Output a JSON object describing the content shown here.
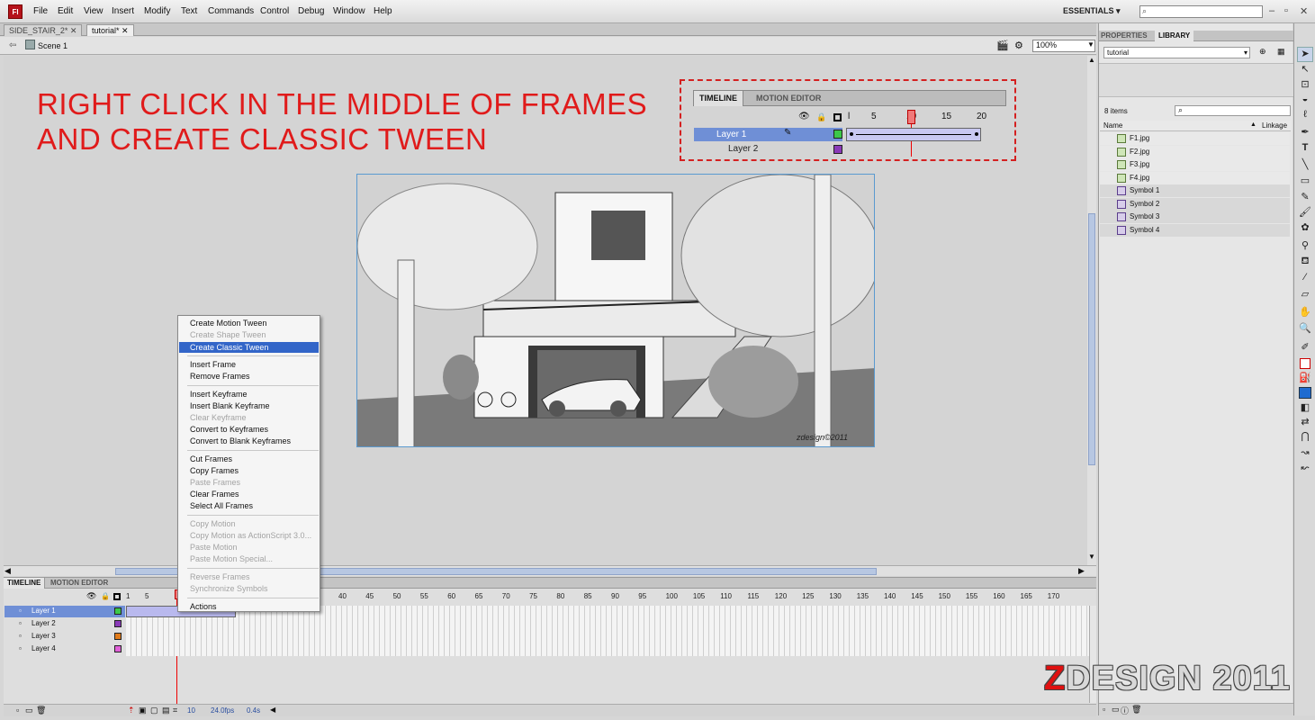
{
  "app": {
    "logo": "Fl"
  },
  "menu": [
    "File",
    "Edit",
    "View",
    "Insert",
    "Modify",
    "Text",
    "Commands",
    "Control",
    "Debug",
    "Window",
    "Help"
  ],
  "workspace": {
    "label": "ESSENTIALS ▾",
    "search_placeholder": ""
  },
  "tabs": [
    {
      "label": "SIDE_STAIR_2*"
    },
    {
      "label": "tutorial*"
    }
  ],
  "editbar": {
    "scene": "Scene 1",
    "zoom": "100%"
  },
  "instruction": {
    "line1": "RIGHT CLICK IN THE MIDDLE OF FRAMES",
    "line2": "AND CREATE CLASSIC TWEEN"
  },
  "inset": {
    "tabs": [
      "TIMELINE",
      "MOTION EDITOR"
    ],
    "ruler": [
      "l",
      "5",
      "10",
      "15",
      "20"
    ],
    "layers": [
      "Layer 1",
      "Layer 2"
    ]
  },
  "photo": {
    "watermark": "zdesign©2011"
  },
  "context_menu": [
    {
      "label": "Create Motion Tween",
      "state": "enabled"
    },
    {
      "label": "Create Shape Tween",
      "state": "disabled"
    },
    {
      "label": "Create Classic Tween",
      "state": "selected"
    },
    {
      "label": "Insert Frame",
      "state": "enabled",
      "sep_before": true
    },
    {
      "label": "Remove Frames",
      "state": "enabled"
    },
    {
      "label": "Insert Keyframe",
      "state": "enabled",
      "sep_before": true
    },
    {
      "label": "Insert Blank Keyframe",
      "state": "enabled"
    },
    {
      "label": "Clear Keyframe",
      "state": "disabled"
    },
    {
      "label": "Convert to Keyframes",
      "state": "enabled"
    },
    {
      "label": "Convert to Blank Keyframes",
      "state": "enabled"
    },
    {
      "label": "Cut Frames",
      "state": "enabled",
      "sep_before": true
    },
    {
      "label": "Copy Frames",
      "state": "enabled"
    },
    {
      "label": "Paste Frames",
      "state": "disabled"
    },
    {
      "label": "Clear Frames",
      "state": "enabled"
    },
    {
      "label": "Select All Frames",
      "state": "enabled"
    },
    {
      "label": "Copy Motion",
      "state": "disabled",
      "sep_before": true
    },
    {
      "label": "Copy Motion as ActionScript 3.0...",
      "state": "disabled"
    },
    {
      "label": "Paste Motion",
      "state": "disabled"
    },
    {
      "label": "Paste Motion Special...",
      "state": "disabled"
    },
    {
      "label": "Reverse Frames",
      "state": "disabled",
      "sep_before": true
    },
    {
      "label": "Synchronize Symbols",
      "state": "disabled"
    },
    {
      "label": "Actions",
      "state": "enabled",
      "sep_before": true
    }
  ],
  "timeline": {
    "tabs": [
      "TIMELINE",
      "MOTION EDITOR"
    ],
    "ruler": [
      "1",
      "5",
      "40",
      "45",
      "50",
      "55",
      "60",
      "65",
      "70",
      "75",
      "80",
      "85",
      "90",
      "95",
      "100",
      "105",
      "110",
      "115",
      "120",
      "125",
      "130",
      "135",
      "140",
      "145",
      "150",
      "155",
      "160",
      "165",
      "170"
    ],
    "layers": [
      {
        "name": "Layer 1",
        "color": "#3cc84a"
      },
      {
        "name": "Layer 2",
        "color": "#8a3ab8"
      },
      {
        "name": "Layer 3",
        "color": "#e07a1a"
      },
      {
        "name": "Layer 4",
        "color": "#e060d8"
      }
    ],
    "status": {
      "frame": "10",
      "fps": "24.0fps",
      "time": "0.4s"
    }
  },
  "panel": {
    "tabs": [
      "PROPERTIES",
      "LIBRARY"
    ],
    "library_doc": "tutorial",
    "item_count": "8 items",
    "col_name": "Name",
    "col_linkage": "Linkage",
    "items": [
      {
        "name": "F1.jpg",
        "kind": "bitmap"
      },
      {
        "name": "F2.jpg",
        "kind": "bitmap"
      },
      {
        "name": "F3.jpg",
        "kind": "bitmap"
      },
      {
        "name": "F4.jpg",
        "kind": "bitmap"
      },
      {
        "name": "Symbol 1",
        "kind": "symbol"
      },
      {
        "name": "Symbol 2",
        "kind": "symbol"
      },
      {
        "name": "Symbol 3",
        "kind": "symbol"
      },
      {
        "name": "Symbol 4",
        "kind": "symbol"
      }
    ]
  },
  "brand": {
    "z": "Z",
    "rest": "DESIGN 2011"
  }
}
